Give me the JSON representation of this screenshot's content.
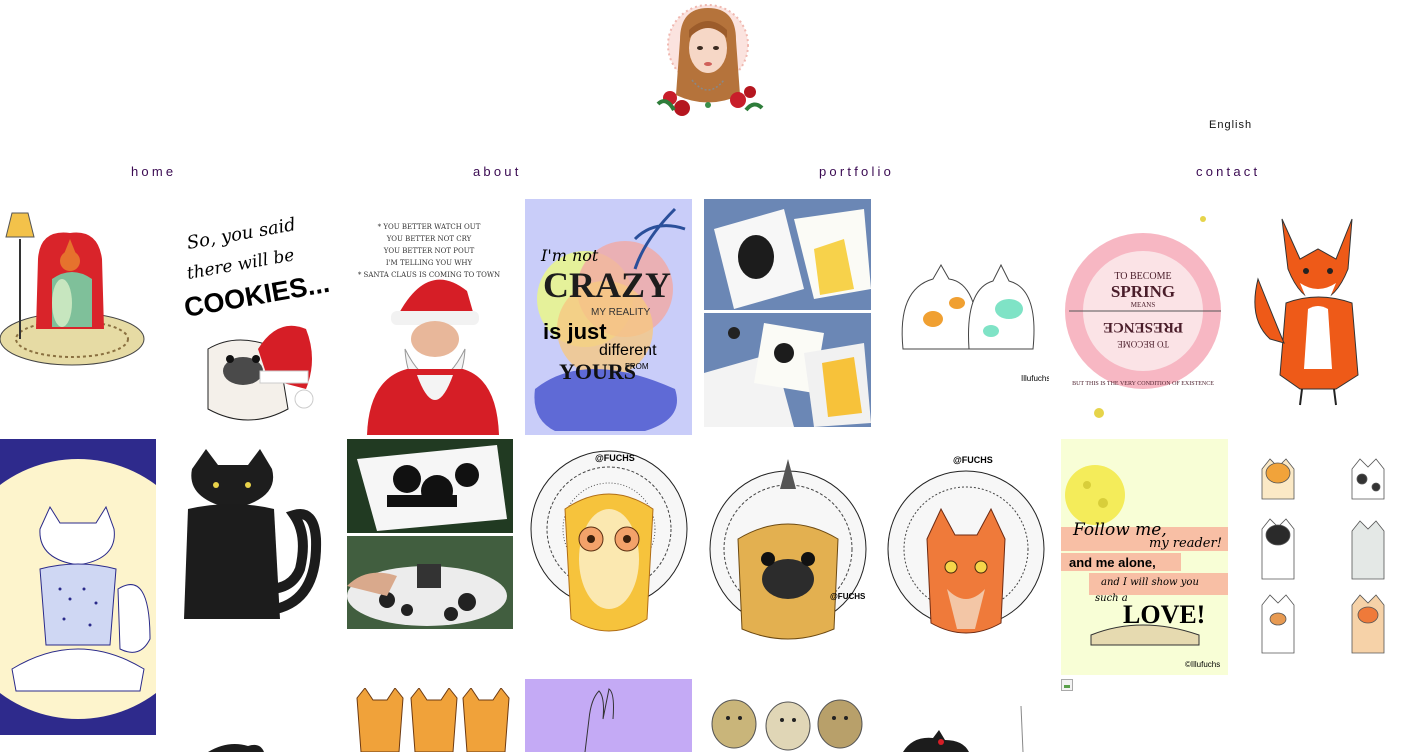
{
  "header": {
    "language_label": "English"
  },
  "nav": {
    "home": "home",
    "about": "about",
    "portfolio": "portfolio",
    "contact": "contact"
  },
  "artworks": {
    "cookies_line1": "So, you said",
    "cookies_line2": "there will be",
    "cookies_line3": "COOKIES...",
    "santa_line1": "* YOU BETTER WATCH OUT",
    "santa_line2": "YOU BETTER NOT CRY",
    "santa_line3": "YOU BETTER NOT POUT",
    "santa_line4": "I'M TELLING YOU WHY",
    "santa_line5": "* SANTA CLAUS IS COMING TO TOWN",
    "crazy_line1": "I'm not",
    "crazy_line2": "CRAZY",
    "crazy_line3": "MY REALITY",
    "crazy_line4": "is just",
    "crazy_line5": "different",
    "crazy_line6": "FROM",
    "crazy_line7": "YOURS",
    "cats_signature": "Illufuchs",
    "spring_line1": "TO BECOME",
    "spring_line2": "SPRING",
    "spring_line3": "MEANS",
    "spring_line4": "TO BECOME",
    "spring_line5": "PRESENCE",
    "spring_line6": "BUT THIS IS THE VERY CONDITION OF EXISTENCE",
    "owl_tag": "@FUCHS",
    "pug_tag": "@FUCHS",
    "fox_tag": "@FUCHS",
    "love_line1": "Follow me,",
    "love_line2": "my reader!",
    "love_line3": "and me alone,",
    "love_line4": "and I will show you",
    "love_line5": "such a",
    "love_line6": "LOVE!",
    "love_signature": "©Illufuchs"
  },
  "colors": {
    "nav": "#3a0a52",
    "crazy_bg": "#c9cdf9",
    "love_bg": "#f8fed6",
    "lilac_bg": "#c4aaf5",
    "moon_bg": "#2e2a8c"
  }
}
